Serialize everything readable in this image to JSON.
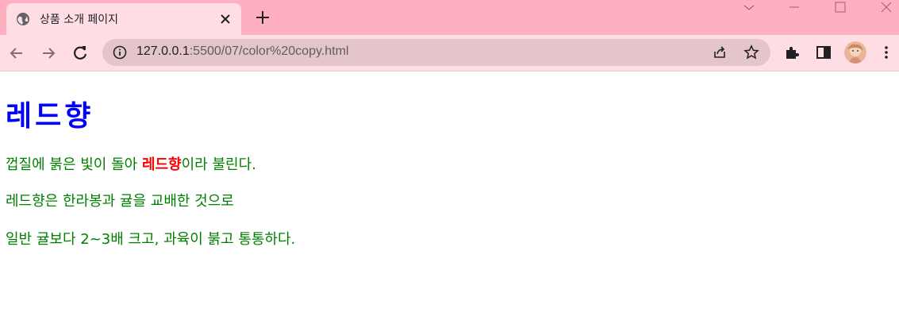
{
  "tab": {
    "title": "상품 소개 페이지",
    "favicon_icon": "globe-icon"
  },
  "toolbar": {
    "url_host": "127.0.0.1",
    "url_rest": ":5500/07/color%20copy.html"
  },
  "page": {
    "heading": "레드향",
    "paragraph1": {
      "before": "껍질에 붉은 빛이 돌아 ",
      "highlight": "레드향",
      "after": "이라 불린다."
    },
    "paragraph2": "레드향은 한라봉과 귤을 교배한 것으로",
    "paragraph3": "일반 귤보다 2~3배 크고, 과육이 붉고 통통하다."
  },
  "colors": {
    "titlebar": "#ffb0c0",
    "toolbar": "#ffdde5",
    "heading": "#0000ff",
    "text": "#008000",
    "highlight": "#ff0000"
  }
}
